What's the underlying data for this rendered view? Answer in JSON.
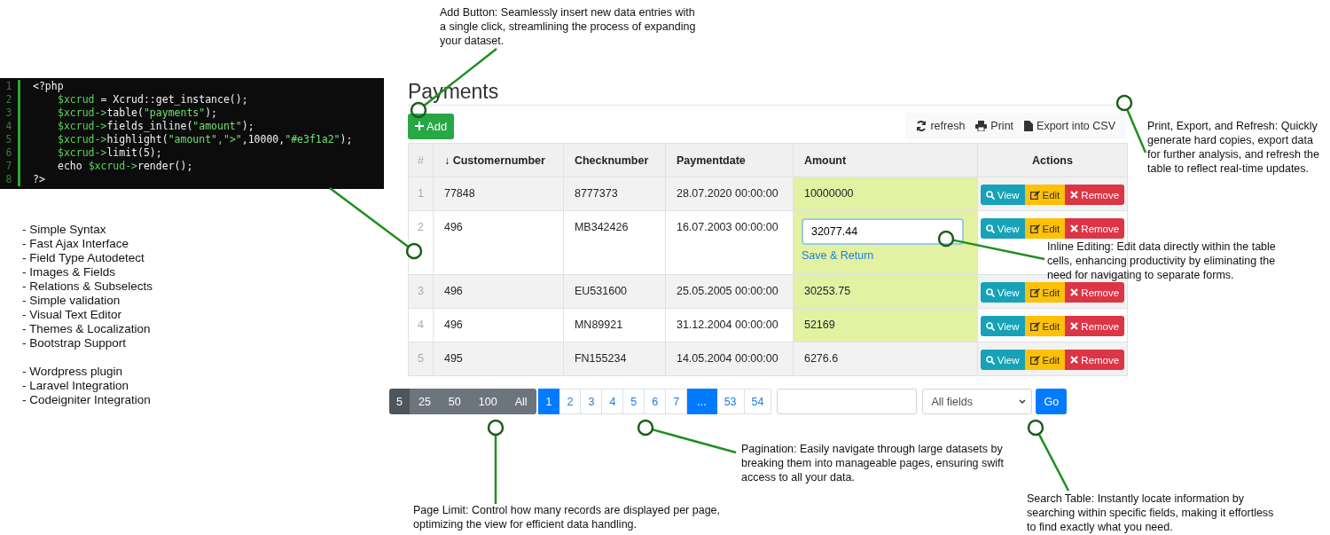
{
  "code": {
    "lines": [
      {
        "number": "1",
        "indented": false,
        "segments": [
          {
            "text": "<?php",
            "kind": "plain"
          }
        ]
      },
      {
        "number": "2",
        "indented": true,
        "segments": [
          {
            "text": "$xcrud",
            "kind": "var"
          },
          {
            "text": " = Xcrud::get_instance();",
            "kind": "plain"
          }
        ]
      },
      {
        "number": "3",
        "indented": true,
        "segments": [
          {
            "text": "$xcrud->",
            "kind": "var"
          },
          {
            "text": "table(",
            "kind": "plain"
          },
          {
            "text": "\"payments\"",
            "kind": "string"
          },
          {
            "text": ");",
            "kind": "plain"
          }
        ]
      },
      {
        "number": "4",
        "indented": true,
        "segments": [
          {
            "text": "$xcrud->",
            "kind": "var"
          },
          {
            "text": "fields_inline(",
            "kind": "plain"
          },
          {
            "text": "\"amount\"",
            "kind": "string"
          },
          {
            "text": ");",
            "kind": "plain"
          }
        ]
      },
      {
        "number": "5",
        "indented": true,
        "segments": [
          {
            "text": "$xcrud->",
            "kind": "var"
          },
          {
            "text": "highlight(",
            "kind": "plain"
          },
          {
            "text": "\"amount\",\">\"",
            "kind": "string"
          },
          {
            "text": ",10000,",
            "kind": "plain"
          },
          {
            "text": "\"#e3f1a2\"",
            "kind": "string"
          },
          {
            "text": ");",
            "kind": "plain"
          }
        ]
      },
      {
        "number": "6",
        "indented": true,
        "segments": [
          {
            "text": "$xcrud->",
            "kind": "var"
          },
          {
            "text": "limit(5);",
            "kind": "plain"
          }
        ]
      },
      {
        "number": "7",
        "indented": true,
        "segments": [
          {
            "text": "echo ",
            "kind": "plain"
          },
          {
            "text": "$xcrud->",
            "kind": "var"
          },
          {
            "text": "render();",
            "kind": "plain"
          }
        ]
      },
      {
        "number": "8",
        "indented": false,
        "segments": [
          {
            "text": "?>",
            "kind": "plain"
          }
        ]
      }
    ]
  },
  "features": [
    [
      "- Simple Syntax",
      "- Fast Ajax Interface",
      "- Field Type Autodetect",
      "- Images & Fields",
      "- Relations & Subselects",
      "- Simple validation",
      "- Visual Text Editor",
      "- Themes & Localization",
      "- Bootstrap Support"
    ],
    [
      "- Wordpress plugin",
      "- Laravel Integration",
      "- Codeigniter Integration"
    ]
  ],
  "title": "Payments",
  "add_button": "Add",
  "toolbar": [
    {
      "label": "refresh",
      "kind": "refresh"
    },
    {
      "label": "Print",
      "kind": "print"
    },
    {
      "label": "Export into CSV",
      "kind": "export"
    }
  ],
  "table": {
    "columns": [
      "#",
      "↓ Customernumber",
      "Checknumber",
      "Paymentdate",
      "Amount",
      "Actions"
    ],
    "rows": [
      {
        "index": "1",
        "customer": "77848",
        "check": "8777373",
        "date": "28.07.2020 00:00:00",
        "amount": "10000000",
        "highlighted": true,
        "editing": false,
        "actions": [
          {
            "label": "View",
            "kind": "view"
          },
          {
            "label": "Edit",
            "kind": "edit"
          },
          {
            "label": "Remove",
            "kind": "remove"
          }
        ]
      },
      {
        "index": "2",
        "customer": "496",
        "check": "MB342426",
        "date": "16.07.2003 00:00:00",
        "amount": "32077.44",
        "highlighted": true,
        "editing": true,
        "save_link": "Save & Return",
        "actions": [
          {
            "label": "View",
            "kind": "view"
          },
          {
            "label": "Edit",
            "kind": "edit"
          },
          {
            "label": "Remove",
            "kind": "remove"
          }
        ]
      },
      {
        "index": "3",
        "customer": "496",
        "check": "EU531600",
        "date": "25.05.2005 00:00:00",
        "amount": "30253.75",
        "highlighted": true,
        "editing": false,
        "actions": [
          {
            "label": "View",
            "kind": "view"
          },
          {
            "label": "Edit",
            "kind": "edit"
          },
          {
            "label": "Remove",
            "kind": "remove"
          }
        ]
      },
      {
        "index": "4",
        "customer": "496",
        "check": "MN89921",
        "date": "31.12.2004 00:00:00",
        "amount": "52169",
        "highlighted": true,
        "editing": false,
        "actions": [
          {
            "label": "View",
            "kind": "view"
          },
          {
            "label": "Edit",
            "kind": "edit"
          },
          {
            "label": "Remove",
            "kind": "remove"
          }
        ]
      },
      {
        "index": "5",
        "customer": "495",
        "check": "FN155234",
        "date": "14.05.2004 00:00:00",
        "amount": "6276.6",
        "highlighted": false,
        "editing": false,
        "actions": [
          {
            "label": "View",
            "kind": "view"
          },
          {
            "label": "Edit",
            "kind": "edit"
          },
          {
            "label": "Remove",
            "kind": "remove"
          }
        ]
      }
    ]
  },
  "limits": [
    {
      "label": "5",
      "selected": true
    },
    {
      "label": "25",
      "selected": false
    },
    {
      "label": "50",
      "selected": false
    },
    {
      "label": "100",
      "selected": false
    },
    {
      "label": "All",
      "selected": false
    }
  ],
  "pages": [
    {
      "label": "1",
      "selected": true
    },
    {
      "label": "2",
      "selected": false
    },
    {
      "label": "3",
      "selected": false
    },
    {
      "label": "4",
      "selected": false
    },
    {
      "label": "5",
      "selected": false
    },
    {
      "label": "6",
      "selected": false
    },
    {
      "label": "7",
      "selected": false
    },
    {
      "label": "...",
      "selected": true
    },
    {
      "label": "53",
      "selected": false
    },
    {
      "label": "54",
      "selected": false
    }
  ],
  "search": {
    "field_select": "All fields",
    "go_button": "Go"
  },
  "annotations": [
    {
      "kind": "add",
      "text": "Add Button: Seamlessly insert new data entries with a single click, streamlining the process of expanding your dataset."
    },
    {
      "kind": "export",
      "text": "Print, Export, and Refresh: Quickly generate hard copies, export data for further analysis,  and refresh the table to reflect real-time updates."
    },
    {
      "kind": "inline",
      "text": "Inline Editing: Edit data directly within the table cells, enhancing productivity by eliminating the need for navigating to separate forms."
    },
    {
      "kind": "pagination",
      "text": "Pagination: Easily navigate through large datasets by breaking them into manageable pages, ensuring swift access to all your data."
    },
    {
      "kind": "limit",
      "text": "Page Limit: Control how many records are displayed per page, optimizing the view for efficient data handling."
    },
    {
      "kind": "search",
      "text": "Search Table: Instantly locate information by searching within specific fields, making it effortless to find exactly what you need."
    }
  ]
}
